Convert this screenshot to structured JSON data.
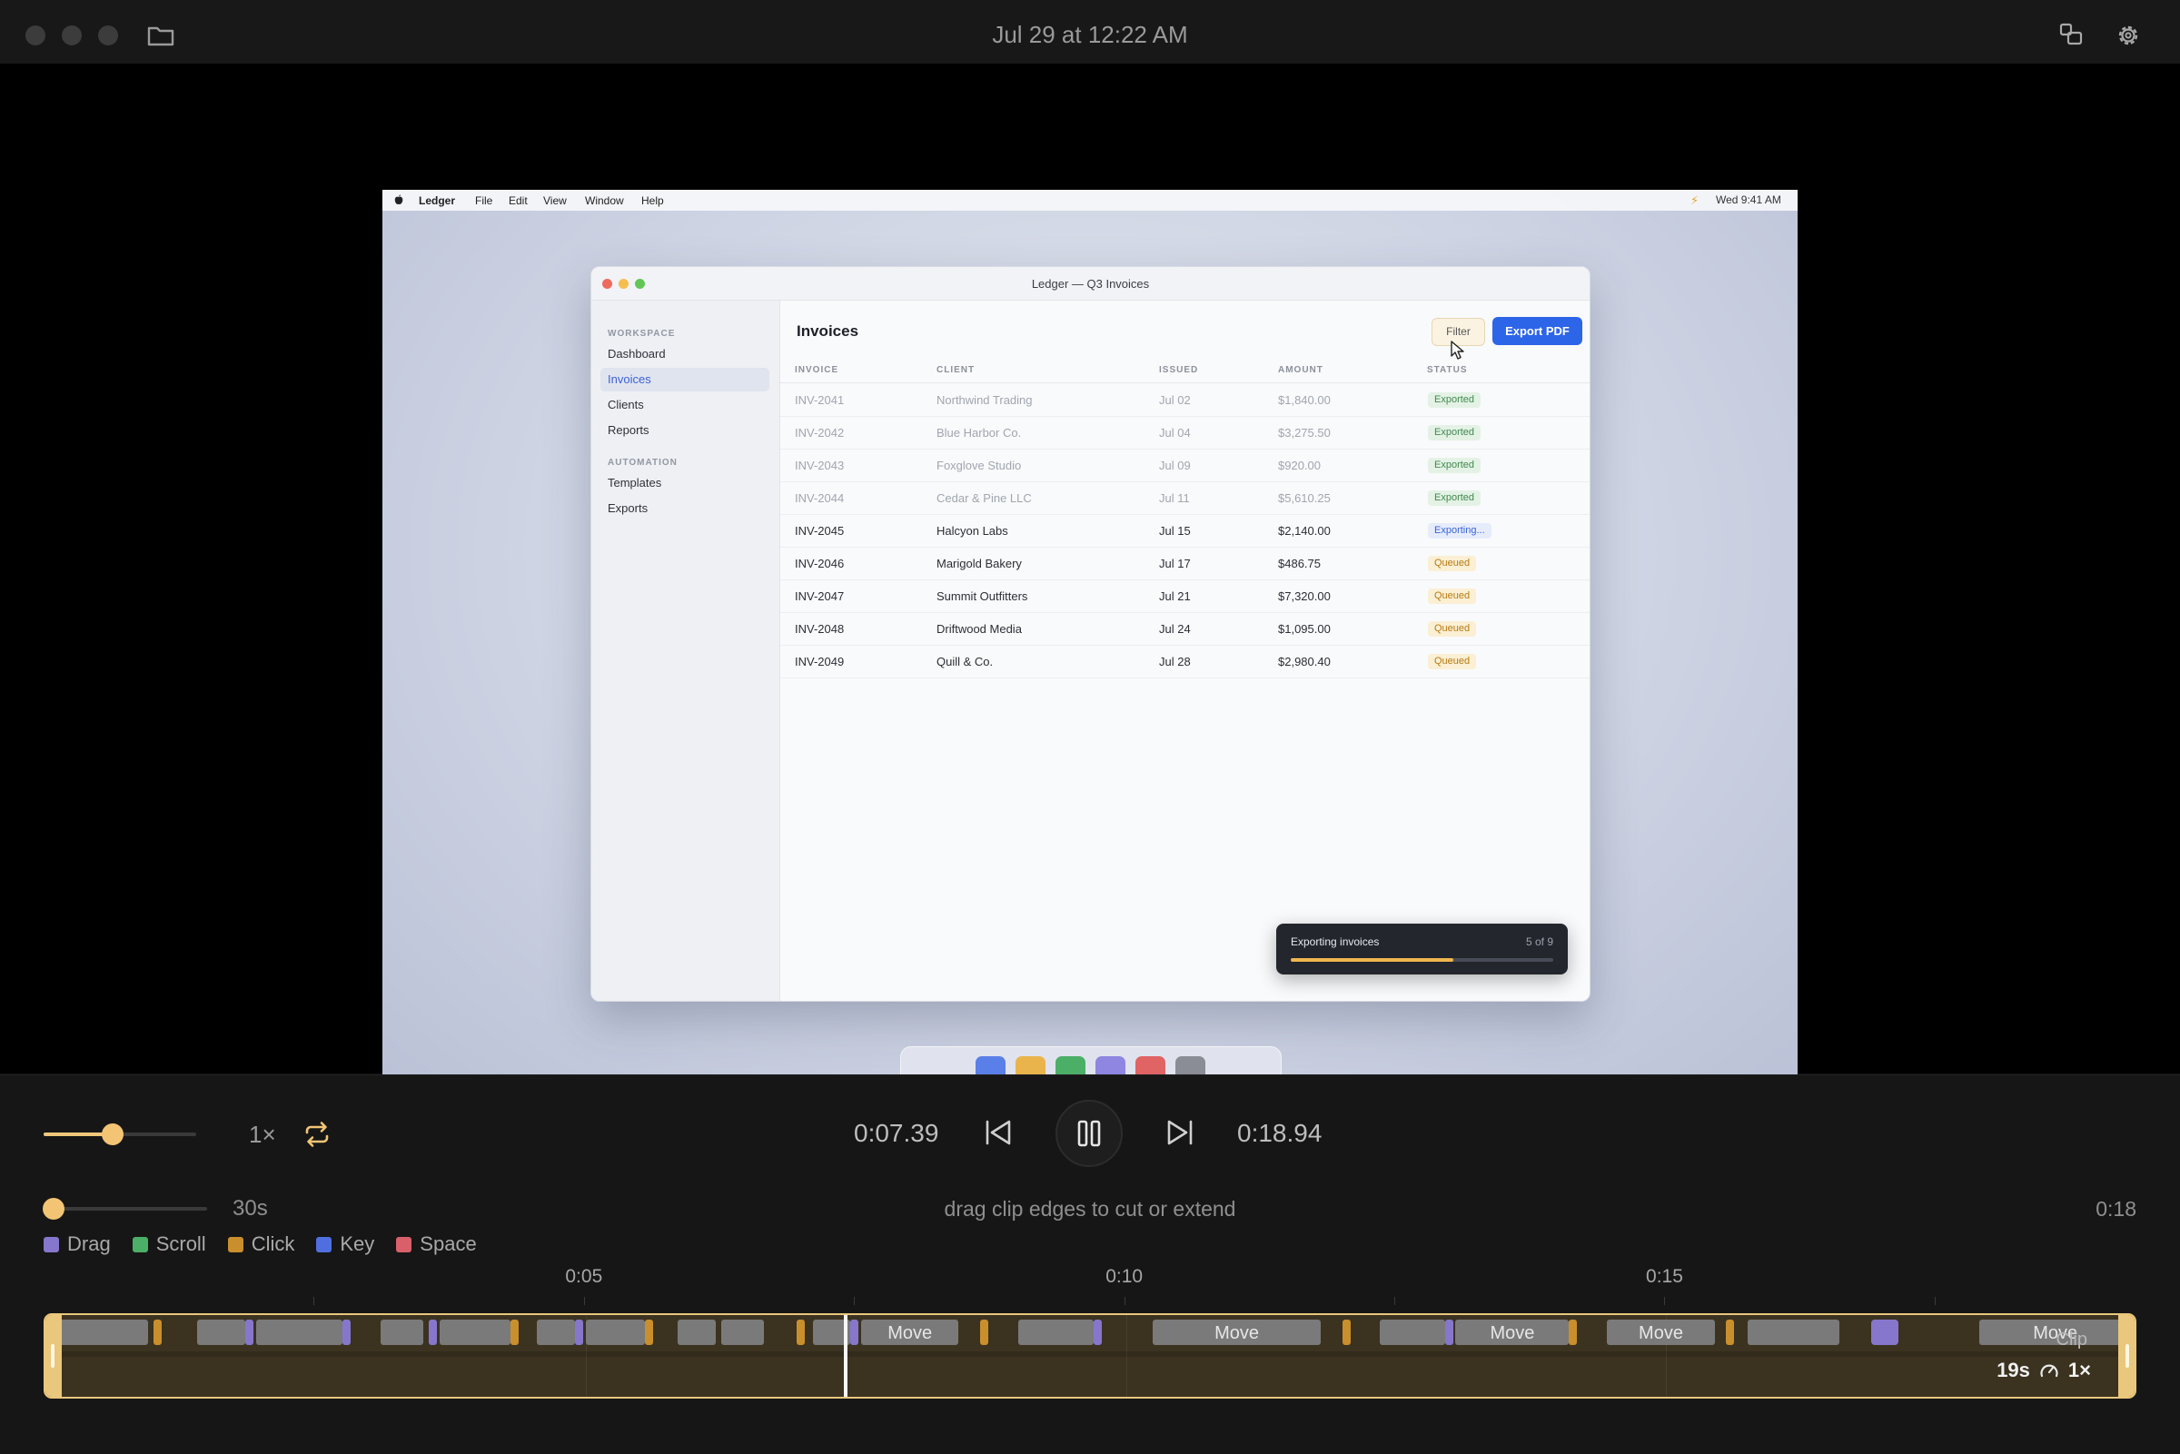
{
  "header": {
    "title": "Jul 29 at 12:22 AM",
    "icons": [
      "folder-icon",
      "split-view-icon",
      "gear-icon"
    ]
  },
  "recording": {
    "menubar": {
      "app_name": "Ledger",
      "menus": [
        "File",
        "Edit",
        "View",
        "Window",
        "Help"
      ],
      "clock": "Wed 9:41 AM"
    },
    "window_title": "Ledger — Q3 Invoices",
    "sidebar": {
      "sections": [
        {
          "title": "WORKSPACE",
          "items": [
            "Dashboard",
            "Invoices",
            "Clients",
            "Reports"
          ]
        },
        {
          "title": "AUTOMATION",
          "items": [
            "Templates",
            "Exports"
          ]
        }
      ],
      "active": "Invoices"
    },
    "page_title": "Invoices",
    "filter_label": "Filter",
    "export_label": "Export PDF",
    "columns": [
      "INVOICE",
      "CLIENT",
      "ISSUED",
      "AMOUNT",
      "STATUS"
    ],
    "rows": [
      {
        "invoice": "INV-2041",
        "client": "Northwind Trading",
        "issued": "Jul 02",
        "amount": "$1,840.00",
        "status": "Exported"
      },
      {
        "invoice": "INV-2042",
        "client": "Blue Harbor Co.",
        "issued": "Jul 04",
        "amount": "$3,275.50",
        "status": "Exported"
      },
      {
        "invoice": "INV-2043",
        "client": "Foxglove Studio",
        "issued": "Jul 09",
        "amount": "$920.00",
        "status": "Exported"
      },
      {
        "invoice": "INV-2044",
        "client": "Cedar & Pine LLC",
        "issued": "Jul 11",
        "amount": "$5,610.25",
        "status": "Exported"
      },
      {
        "invoice": "INV-2045",
        "client": "Halcyon Labs",
        "issued": "Jul 15",
        "amount": "$2,140.00",
        "status": "Exporting..."
      },
      {
        "invoice": "INV-2046",
        "client": "Marigold Bakery",
        "issued": "Jul 17",
        "amount": "$486.75",
        "status": "Queued"
      },
      {
        "invoice": "INV-2047",
        "client": "Summit Outfitters",
        "issued": "Jul 21",
        "amount": "$7,320.00",
        "status": "Queued"
      },
      {
        "invoice": "INV-2048",
        "client": "Driftwood Media",
        "issued": "Jul 24",
        "amount": "$1,095.00",
        "status": "Queued"
      },
      {
        "invoice": "INV-2049",
        "client": "Quill & Co.",
        "issued": "Jul 28",
        "amount": "$2,980.40",
        "status": "Queued"
      }
    ],
    "toast": {
      "title": "Exporting invoices",
      "count": "5 of 9",
      "progress": 0.62
    },
    "dock_colors": [
      "#5b7fe8",
      "#e9b44c",
      "#4caf68",
      "#8e86e0",
      "#e06464",
      "#8a8d95"
    ]
  },
  "controls": {
    "volume_level": 0.45,
    "speed": "1×",
    "time_current": "0:07.39",
    "time_total": "0:18.94",
    "zoom_level": 0.0,
    "zoom_label": "30s",
    "hint": "drag clip edges to cut or extend",
    "clip_duration": "0:18"
  },
  "legend": [
    {
      "label": "Drag",
      "color": "#8677cc"
    },
    {
      "label": "Scroll",
      "color": "#4caf68"
    },
    {
      "label": "Click",
      "color": "#c98f2c"
    },
    {
      "label": "Key",
      "color": "#4f6fe0"
    },
    {
      "label": "Space",
      "color": "#d9606a"
    }
  ],
  "ruler": {
    "labels": [
      {
        "t": 5,
        "label": "0:05"
      },
      {
        "t": 10,
        "label": "0:10"
      },
      {
        "t": 15,
        "label": "0:15"
      }
    ],
    "minor_ticks": [
      2.5,
      7.5,
      12.5,
      17.5
    ]
  },
  "timeline": {
    "duration_seconds": 19.3,
    "playhead_seconds": 7.39,
    "move_label": "Move",
    "events": [
      {
        "type": "move",
        "start": 0.1,
        "end": 0.95,
        "label": ""
      },
      {
        "type": "click",
        "start": 1.0
      },
      {
        "type": "move",
        "start": 1.4,
        "end": 1.85,
        "label": ""
      },
      {
        "type": "drag",
        "start": 1.85
      },
      {
        "type": "move",
        "start": 1.95,
        "end": 2.75,
        "label": ""
      },
      {
        "type": "drag",
        "start": 2.75
      },
      {
        "type": "move",
        "start": 3.1,
        "end": 3.5,
        "label": ""
      },
      {
        "type": "drag",
        "start": 3.55
      },
      {
        "type": "move",
        "start": 3.65,
        "end": 4.3,
        "label": ""
      },
      {
        "type": "click",
        "start": 4.3
      },
      {
        "type": "move",
        "start": 4.55,
        "end": 4.9,
        "label": ""
      },
      {
        "type": "drag",
        "start": 4.9
      },
      {
        "type": "move",
        "start": 5.0,
        "end": 5.55,
        "label": ""
      },
      {
        "type": "click",
        "start": 5.55
      },
      {
        "type": "move",
        "start": 5.85,
        "end": 6.2,
        "label": ""
      },
      {
        "type": "move",
        "start": 6.25,
        "end": 6.65,
        "label": ""
      },
      {
        "type": "click",
        "start": 6.95
      },
      {
        "type": "move",
        "start": 7.1,
        "end": 7.45,
        "label": ""
      },
      {
        "type": "drag",
        "start": 7.45
      },
      {
        "type": "move",
        "start": 7.55,
        "end": 8.45,
        "label": "Move"
      },
      {
        "type": "click",
        "start": 8.65
      },
      {
        "type": "move",
        "start": 9.0,
        "end": 9.7,
        "label": ""
      },
      {
        "type": "drag",
        "start": 9.7
      },
      {
        "type": "move",
        "start": 10.25,
        "end": 11.8,
        "label": "Move"
      },
      {
        "type": "click",
        "start": 12.0
      },
      {
        "type": "move",
        "start": 12.35,
        "end": 12.95,
        "label": ""
      },
      {
        "type": "drag",
        "start": 12.95
      },
      {
        "type": "move",
        "start": 13.05,
        "end": 14.1,
        "label": "Move"
      },
      {
        "type": "click",
        "start": 14.1
      },
      {
        "type": "move",
        "start": 14.45,
        "end": 15.45,
        "label": "Move"
      },
      {
        "type": "click",
        "start": 15.55
      },
      {
        "type": "move",
        "start": 15.75,
        "end": 16.6,
        "label": ""
      },
      {
        "type": "drag",
        "start": 16.9,
        "end": 17.15
      },
      {
        "type": "move",
        "start": 17.9,
        "end": 19.3,
        "label": "Move"
      }
    ],
    "clip_tag": "Clip",
    "clip_length": "19s",
    "clip_speed": "1×"
  }
}
